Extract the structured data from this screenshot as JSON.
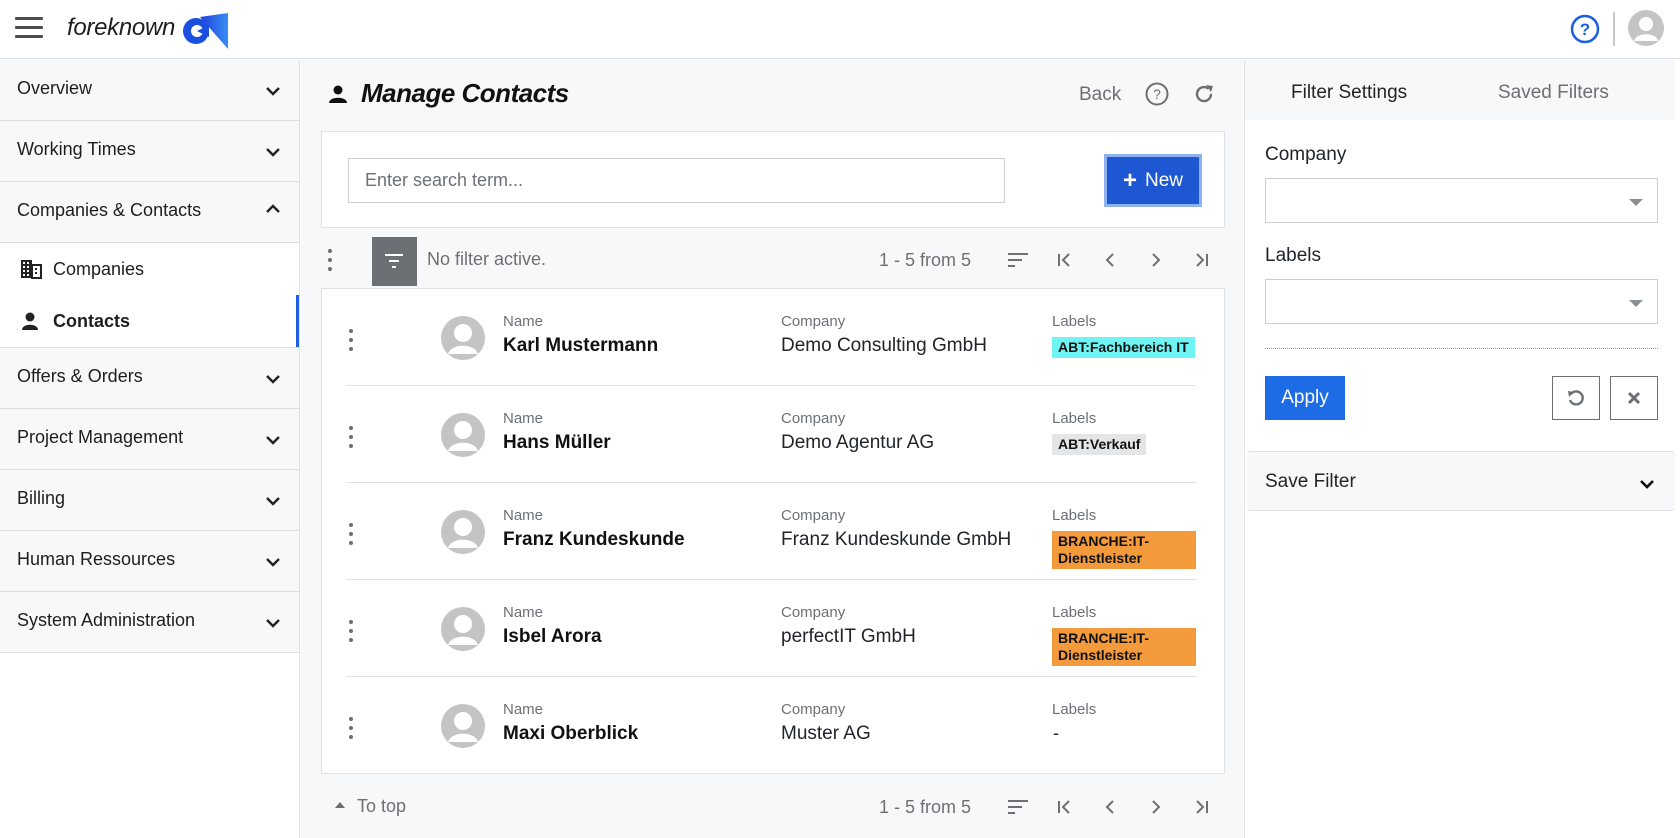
{
  "app": {
    "brand": "foreknown",
    "accent_color": "#1d57d1"
  },
  "sidebar": {
    "groups_top": [
      {
        "label": "Overview",
        "expanded": false
      },
      {
        "label": "Working Times",
        "expanded": false
      },
      {
        "label": "Companies & Contacts",
        "expanded": true
      }
    ],
    "sub_items": [
      {
        "label": "Companies",
        "icon": "building-icon",
        "active": false
      },
      {
        "label": "Contacts",
        "icon": "person-icon",
        "active": true
      }
    ],
    "groups_bottom": [
      {
        "label": "Offers & Orders",
        "expanded": false
      },
      {
        "label": "Project Management",
        "expanded": false
      },
      {
        "label": "Billing",
        "expanded": false
      },
      {
        "label": "Human Ressources",
        "expanded": false
      },
      {
        "label": "System Administration",
        "expanded": false
      }
    ]
  },
  "main": {
    "title": "Manage Contacts",
    "back_label": "Back",
    "search": {
      "placeholder": "Enter search term...",
      "value": ""
    },
    "new_button": "New",
    "filter_status": "No filter active.",
    "pagination": "1 - 5 from 5",
    "to_top": "To top",
    "column_labels": {
      "name": "Name",
      "company": "Company",
      "labels": "Labels"
    },
    "contacts": [
      {
        "name": "Karl Mustermann",
        "company": "Demo Consulting GmbH",
        "label": "ABT:Fachbereich IT",
        "label_color": "#6ff4f4"
      },
      {
        "name": "Hans Müller",
        "company": "Demo Agentur AG",
        "label": "ABT:Verkauf",
        "label_color": "#e4e5e7"
      },
      {
        "name": "Franz Kundeskunde",
        "company": "Franz Kundeskunde GmbH",
        "label": "BRANCHE:IT-Dienstleister",
        "label_color": "#f39a3c"
      },
      {
        "name": "Isbel Arora",
        "company": "perfectIT GmbH",
        "label": "BRANCHE:IT-Dienstleister",
        "label_color": "#f39a3c"
      },
      {
        "name": "Maxi Oberblick",
        "company": "Muster AG",
        "label": "-",
        "label_color": null
      }
    ]
  },
  "filter_panel": {
    "tabs": [
      {
        "label": "Filter Settings",
        "active": true
      },
      {
        "label": "Saved Filters",
        "active": false
      }
    ],
    "company_label": "Company",
    "company_value": "",
    "labels_label": "Labels",
    "labels_value": "",
    "apply_label": "Apply",
    "save_filter_label": "Save Filter"
  }
}
